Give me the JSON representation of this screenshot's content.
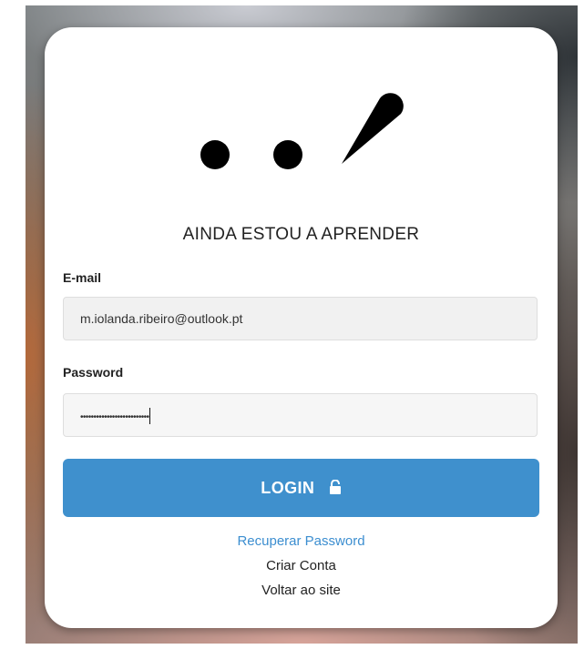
{
  "brand": {
    "title": "AINDA ESTOU A APRENDER"
  },
  "form": {
    "email_label": "E-mail",
    "email_value": "m.iolanda.ribeiro@outlook.pt",
    "password_label": "Password",
    "password_mask": "••••••••••••••••••••••••••"
  },
  "actions": {
    "login_label": "LOGIN"
  },
  "links": {
    "recover": "Recuperar Password",
    "create": "Criar Conta",
    "back": "Voltar ao site"
  },
  "colors": {
    "primary": "#3f90cd",
    "link": "#3c8ed0"
  },
  "icons": {
    "login": "lock-open-icon",
    "logo": "dots-pin-logo-icon"
  }
}
